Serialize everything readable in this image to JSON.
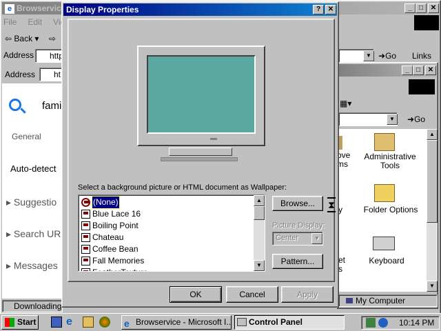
{
  "browser": {
    "title": "Browservice",
    "menu": [
      "File",
      "Edit",
      "Vie"
    ],
    "back_label": "Back",
    "address_label": "Address",
    "address_value": "http",
    "go_label": "Go",
    "links_label": "Links",
    "status": "Downloading p"
  },
  "inner_browser": {
    "address_label": "Address",
    "address_value": "ht",
    "search_text": "fami",
    "tab_general": "General",
    "auto_detect": "Auto-detect",
    "items": [
      "Suggestio",
      "Search UR",
      "Messages"
    ]
  },
  "control_panel": {
    "go_label": "Go",
    "icons": [
      {
        "label": "ove\nms",
        "name": "add-remove-programs-icon"
      },
      {
        "label": "Administrative\nTools",
        "name": "administrative-tools-icon"
      },
      {
        "label": "y",
        "name": "display-icon"
      },
      {
        "label": "Folder Options",
        "name": "folder-options-icon"
      },
      {
        "label": "et\ns",
        "name": "internet-options-icon"
      },
      {
        "label": "Keyboard",
        "name": "keyboard-icon"
      }
    ],
    "status": "My Computer"
  },
  "dialog": {
    "title": "Display Properties",
    "wallpaper_label": "Select a background picture or HTML document as Wallpaper:",
    "wallpapers": [
      "(None)",
      "Blue Lace 16",
      "Boiling Point",
      "Chateau",
      "Coffee Bean",
      "Fall Memories",
      "FeatherTexture"
    ],
    "selected_index": 0,
    "browse_label": "Browse...",
    "picture_display_label": "Picture Display:",
    "picture_display_value": "Center",
    "pattern_label": "Pattern...",
    "ok_label": "OK",
    "cancel_label": "Cancel",
    "apply_label": "Apply",
    "help_btn": "?",
    "close_btn": "✕"
  },
  "taskbar": {
    "start_label": "Start",
    "tasks": [
      "Browservice - Microsoft I...",
      "Control Panel"
    ],
    "time": "10:14 PM"
  },
  "colors": {
    "desktop": "#008080",
    "monitor_screen": "#5aa8a0",
    "titlebar": "#000080"
  }
}
